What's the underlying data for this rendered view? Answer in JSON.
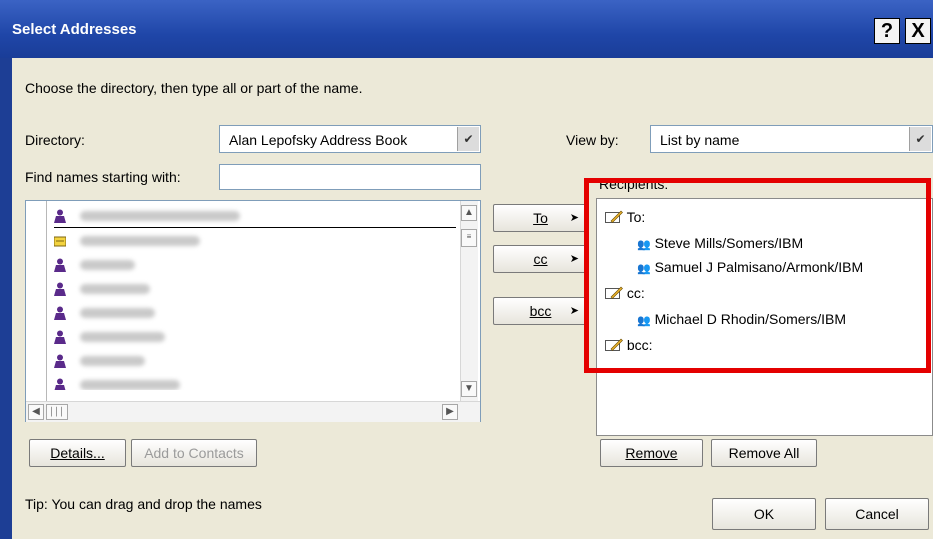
{
  "window": {
    "title": "Select Addresses",
    "help_label": "?",
    "close_label": "X"
  },
  "instructions": "Choose the directory, then type all or part of the name.",
  "directory": {
    "label_u": "Directory:",
    "value": "Alan Lepofsky Address Book"
  },
  "view_by": {
    "label": "View by:",
    "value": "List by name"
  },
  "find": {
    "label": "Find names starting with:",
    "value": ""
  },
  "names": [
    {
      "icon": "person-icon"
    },
    {
      "icon": "group-icon"
    },
    {
      "icon": "person-icon"
    },
    {
      "icon": "person-icon"
    },
    {
      "icon": "person-icon"
    },
    {
      "icon": "person-icon"
    },
    {
      "icon": "person-icon"
    },
    {
      "icon": "person-icon"
    }
  ],
  "add_buttons": {
    "to": "To",
    "cc": "cc",
    "bcc": "bcc"
  },
  "recipients": {
    "label": "Recipients:",
    "to_label": "To:",
    "to": [
      "Steve Mills/Somers/IBM",
      "Samuel J Palmisano/Armonk/IBM"
    ],
    "cc_label": "cc:",
    "cc": [
      "Michael D Rhodin/Somers/IBM"
    ],
    "bcc_label": "bcc:"
  },
  "buttons": {
    "details": "Details...",
    "add_to_contacts": "Add to Contacts",
    "remove": "Remove",
    "remove_all": "Remove All",
    "ok": "OK",
    "cancel": "Cancel"
  },
  "tip": "Tip: You can drag and drop the names",
  "colors": {
    "highlight_box": "#e40000",
    "titlebar": "#1f46a8"
  }
}
